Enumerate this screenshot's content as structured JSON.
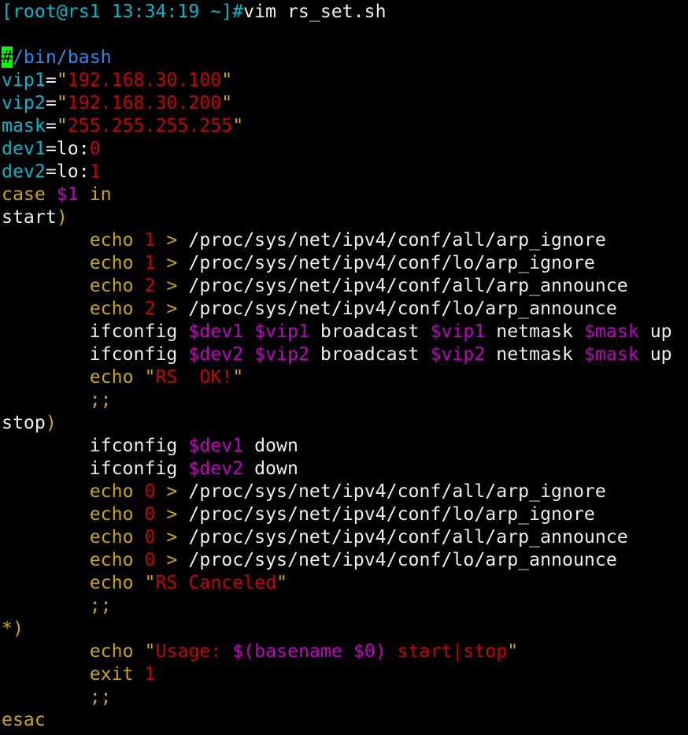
{
  "colors": {
    "cyan": "#00b8c8",
    "blue": "#2a8ae6",
    "red": "#c80000",
    "yellow": "#c8a800",
    "magenta": "#c000c0",
    "white": "#ececec",
    "cursor": "#00ff00"
  },
  "lines": [
    [
      {
        "t": "[root@rs1 13:34:19 ~]#",
        "c": "cyan"
      },
      {
        "t": "vim rs_set.sh",
        "c": "white"
      }
    ],
    [],
    [
      {
        "t": "#",
        "c": "cursor"
      },
      {
        "t": "/bin/bash",
        "c": "blue"
      }
    ],
    [
      {
        "t": "vip1",
        "c": "cyan"
      },
      {
        "t": "=",
        "c": "white"
      },
      {
        "t": "\"",
        "c": "yellow"
      },
      {
        "t": "192.168.30.100",
        "c": "red"
      },
      {
        "t": "\"",
        "c": "yellow"
      }
    ],
    [
      {
        "t": "vip2",
        "c": "cyan"
      },
      {
        "t": "=",
        "c": "white"
      },
      {
        "t": "\"",
        "c": "yellow"
      },
      {
        "t": "192.168.30.200",
        "c": "red"
      },
      {
        "t": "\"",
        "c": "yellow"
      }
    ],
    [
      {
        "t": "mask",
        "c": "cyan"
      },
      {
        "t": "=",
        "c": "white"
      },
      {
        "t": "\"",
        "c": "yellow"
      },
      {
        "t": "255.255.255.255",
        "c": "red"
      },
      {
        "t": "\"",
        "c": "yellow"
      }
    ],
    [
      {
        "t": "dev1",
        "c": "cyan"
      },
      {
        "t": "=lo:",
        "c": "white"
      },
      {
        "t": "0",
        "c": "red"
      }
    ],
    [
      {
        "t": "dev2",
        "c": "cyan"
      },
      {
        "t": "=lo:",
        "c": "white"
      },
      {
        "t": "1",
        "c": "red"
      }
    ],
    [
      {
        "t": "case",
        "c": "yellow"
      },
      {
        "t": " ",
        "c": "white"
      },
      {
        "t": "$1",
        "c": "magenta"
      },
      {
        "t": " ",
        "c": "white"
      },
      {
        "t": "in",
        "c": "yellow"
      }
    ],
    [
      {
        "t": "start",
        "c": "white"
      },
      {
        "t": ")",
        "c": "yellow"
      }
    ],
    [
      {
        "t": "        ",
        "c": "white"
      },
      {
        "t": "echo",
        "c": "yellow"
      },
      {
        "t": " ",
        "c": "white"
      },
      {
        "t": "1",
        "c": "red"
      },
      {
        "t": " > ",
        "c": "yellow"
      },
      {
        "t": "/proc/sys/net/ipv4/conf/all/arp_ignore",
        "c": "white"
      }
    ],
    [
      {
        "t": "        ",
        "c": "white"
      },
      {
        "t": "echo",
        "c": "yellow"
      },
      {
        "t": " ",
        "c": "white"
      },
      {
        "t": "1",
        "c": "red"
      },
      {
        "t": " > ",
        "c": "yellow"
      },
      {
        "t": "/proc/sys/net/ipv4/conf/lo/arp_ignore",
        "c": "white"
      }
    ],
    [
      {
        "t": "        ",
        "c": "white"
      },
      {
        "t": "echo",
        "c": "yellow"
      },
      {
        "t": " ",
        "c": "white"
      },
      {
        "t": "2",
        "c": "red"
      },
      {
        "t": " > ",
        "c": "yellow"
      },
      {
        "t": "/proc/sys/net/ipv4/conf/all/arp_announce",
        "c": "white"
      }
    ],
    [
      {
        "t": "        ",
        "c": "white"
      },
      {
        "t": "echo",
        "c": "yellow"
      },
      {
        "t": " ",
        "c": "white"
      },
      {
        "t": "2",
        "c": "red"
      },
      {
        "t": " > ",
        "c": "yellow"
      },
      {
        "t": "/proc/sys/net/ipv4/conf/lo/arp_announce",
        "c": "white"
      }
    ],
    [
      {
        "t": "        ifconfig ",
        "c": "white"
      },
      {
        "t": "$dev1",
        "c": "magenta"
      },
      {
        "t": " ",
        "c": "white"
      },
      {
        "t": "$vip1",
        "c": "magenta"
      },
      {
        "t": " broadcast ",
        "c": "white"
      },
      {
        "t": "$vip1",
        "c": "magenta"
      },
      {
        "t": " netmask ",
        "c": "white"
      },
      {
        "t": "$mask",
        "c": "magenta"
      },
      {
        "t": " up",
        "c": "white"
      }
    ],
    [
      {
        "t": "        ifconfig ",
        "c": "white"
      },
      {
        "t": "$dev2",
        "c": "magenta"
      },
      {
        "t": " ",
        "c": "white"
      },
      {
        "t": "$vip2",
        "c": "magenta"
      },
      {
        "t": " broadcast ",
        "c": "white"
      },
      {
        "t": "$vip2",
        "c": "magenta"
      },
      {
        "t": " netmask ",
        "c": "white"
      },
      {
        "t": "$mask",
        "c": "magenta"
      },
      {
        "t": " up",
        "c": "white"
      }
    ],
    [
      {
        "t": "        ",
        "c": "white"
      },
      {
        "t": "echo",
        "c": "yellow"
      },
      {
        "t": " ",
        "c": "white"
      },
      {
        "t": "\"",
        "c": "yellow"
      },
      {
        "t": "RS  OK!",
        "c": "red"
      },
      {
        "t": "\"",
        "c": "yellow"
      }
    ],
    [
      {
        "t": "        ",
        "c": "white"
      },
      {
        "t": ";;",
        "c": "yellow"
      }
    ],
    [
      {
        "t": "stop",
        "c": "white"
      },
      {
        "t": ")",
        "c": "yellow"
      }
    ],
    [
      {
        "t": "        ifconfig ",
        "c": "white"
      },
      {
        "t": "$dev1",
        "c": "magenta"
      },
      {
        "t": " down",
        "c": "white"
      }
    ],
    [
      {
        "t": "        ifconfig ",
        "c": "white"
      },
      {
        "t": "$dev2",
        "c": "magenta"
      },
      {
        "t": " down",
        "c": "white"
      }
    ],
    [
      {
        "t": "        ",
        "c": "white"
      },
      {
        "t": "echo",
        "c": "yellow"
      },
      {
        "t": " ",
        "c": "white"
      },
      {
        "t": "0",
        "c": "red"
      },
      {
        "t": " > ",
        "c": "yellow"
      },
      {
        "t": "/proc/sys/net/ipv4/conf/all/arp_ignore",
        "c": "white"
      }
    ],
    [
      {
        "t": "        ",
        "c": "white"
      },
      {
        "t": "echo",
        "c": "yellow"
      },
      {
        "t": " ",
        "c": "white"
      },
      {
        "t": "0",
        "c": "red"
      },
      {
        "t": " > ",
        "c": "yellow"
      },
      {
        "t": "/proc/sys/net/ipv4/conf/lo/arp_ignore",
        "c": "white"
      }
    ],
    [
      {
        "t": "        ",
        "c": "white"
      },
      {
        "t": "echo",
        "c": "yellow"
      },
      {
        "t": " ",
        "c": "white"
      },
      {
        "t": "0",
        "c": "red"
      },
      {
        "t": " > ",
        "c": "yellow"
      },
      {
        "t": "/proc/sys/net/ipv4/conf/all/arp_announce",
        "c": "white"
      }
    ],
    [
      {
        "t": "        ",
        "c": "white"
      },
      {
        "t": "echo",
        "c": "yellow"
      },
      {
        "t": " ",
        "c": "white"
      },
      {
        "t": "0",
        "c": "red"
      },
      {
        "t": " > ",
        "c": "yellow"
      },
      {
        "t": "/proc/sys/net/ipv4/conf/lo/arp_announce",
        "c": "white"
      }
    ],
    [
      {
        "t": "        ",
        "c": "white"
      },
      {
        "t": "echo",
        "c": "yellow"
      },
      {
        "t": " ",
        "c": "white"
      },
      {
        "t": "\"",
        "c": "yellow"
      },
      {
        "t": "RS Canceled",
        "c": "red"
      },
      {
        "t": "\"",
        "c": "yellow"
      }
    ],
    [
      {
        "t": "        ",
        "c": "white"
      },
      {
        "t": ";;",
        "c": "yellow"
      }
    ],
    [
      {
        "t": "*)",
        "c": "yellow"
      }
    ],
    [
      {
        "t": "        ",
        "c": "white"
      },
      {
        "t": "echo",
        "c": "yellow"
      },
      {
        "t": " ",
        "c": "white"
      },
      {
        "t": "\"",
        "c": "yellow"
      },
      {
        "t": "Usage: ",
        "c": "red"
      },
      {
        "t": "$(basename $0)",
        "c": "magenta"
      },
      {
        "t": " start|stop",
        "c": "red"
      },
      {
        "t": "\"",
        "c": "yellow"
      }
    ],
    [
      {
        "t": "        ",
        "c": "white"
      },
      {
        "t": "exit",
        "c": "yellow"
      },
      {
        "t": " ",
        "c": "white"
      },
      {
        "t": "1",
        "c": "red"
      }
    ],
    [
      {
        "t": "        ",
        "c": "white"
      },
      {
        "t": ";;",
        "c": "yellow"
      }
    ],
    [
      {
        "t": "esac",
        "c": "yellow"
      }
    ]
  ]
}
